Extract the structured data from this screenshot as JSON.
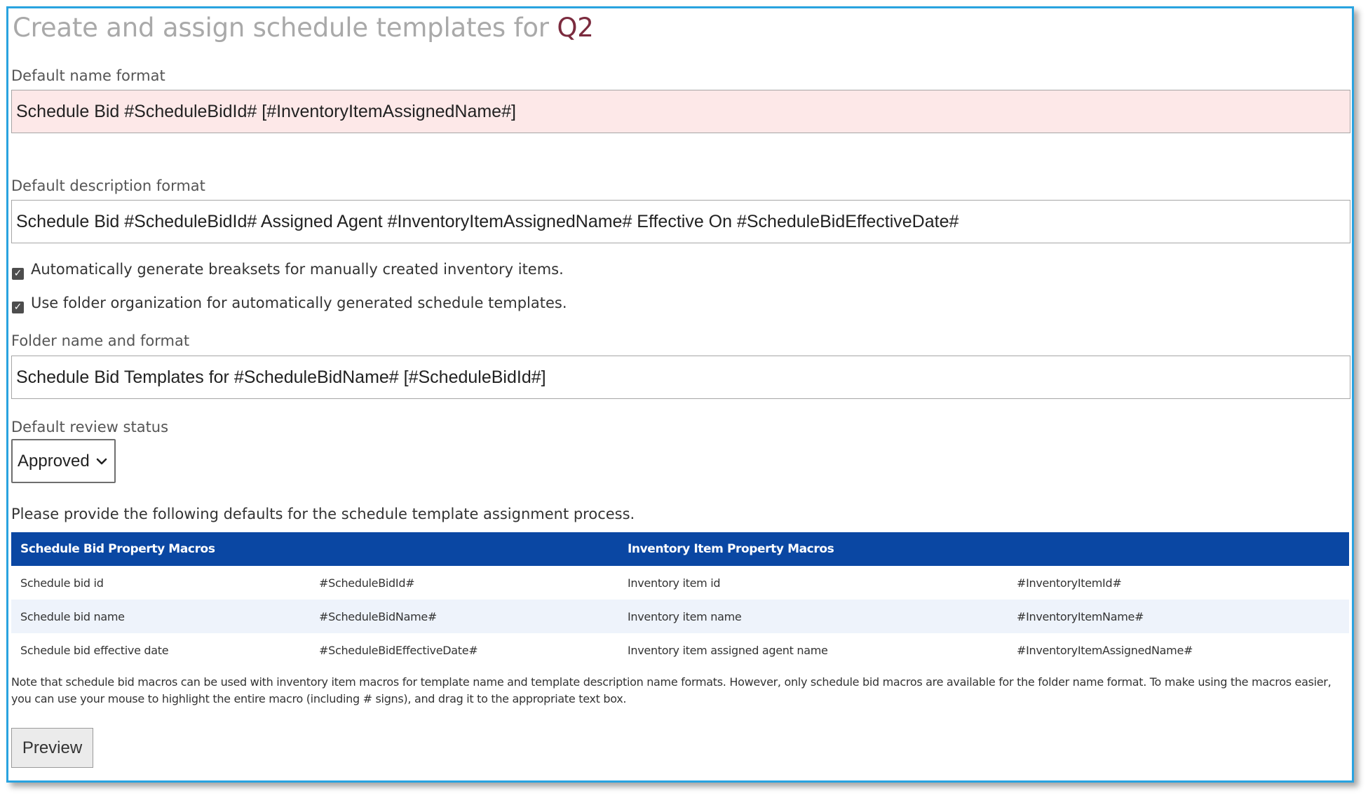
{
  "title": {
    "prefix": "Create and assign schedule templates for ",
    "entity": "Q2"
  },
  "name_format": {
    "label": "Default name format",
    "value": "Schedule Bid #ScheduleBidId# [#InventoryItemAssignedName#]"
  },
  "description_format": {
    "label": "Default description format",
    "value": "Schedule Bid #ScheduleBidId# Assigned Agent #InventoryItemAssignedName# Effective On #ScheduleBidEffectiveDate#"
  },
  "options": {
    "auto_breaksets": {
      "label": "Automatically generate breaksets for manually created inventory items.",
      "checked": true
    },
    "folder_organization": {
      "label": "Use folder organization for automatically generated schedule templates.",
      "checked": true
    }
  },
  "folder_format": {
    "label": "Folder name and format",
    "value": "Schedule Bid Templates for #ScheduleBidName# [#ScheduleBidId#]"
  },
  "review_status": {
    "label": "Default review status",
    "selected": "Approved"
  },
  "assignment_intro": "Please provide the following defaults for the schedule template assignment process.",
  "macros": {
    "headers": [
      "Schedule Bid Property Macros",
      "Inventory Item Property Macros"
    ],
    "rows": [
      [
        "Schedule bid id",
        "#ScheduleBidId#",
        "Inventory item id",
        "#InventoryItemId#"
      ],
      [
        "Schedule bid name",
        "#ScheduleBidName#",
        "Inventory item name",
        "#InventoryItemName#"
      ],
      [
        "Schedule bid effective date",
        "#ScheduleBidEffectiveDate#",
        "Inventory item assigned agent name",
        "#InventoryItemAssignedName#"
      ]
    ]
  },
  "note": "Note that schedule bid macros can be used with inventory item macros for template name and template description name formats. However, only schedule bid macros are available for the folder name format. To make using the macros easier, you can use your mouse to highlight the entire macro (including # signs), and drag it to the appropriate text box.",
  "preview_button": "Preview",
  "colors": {
    "frame_border": "#29a3e0",
    "table_header": "#0a47a3",
    "invalid_field": "#fde8e8",
    "title_accent": "#7b2b3e"
  }
}
